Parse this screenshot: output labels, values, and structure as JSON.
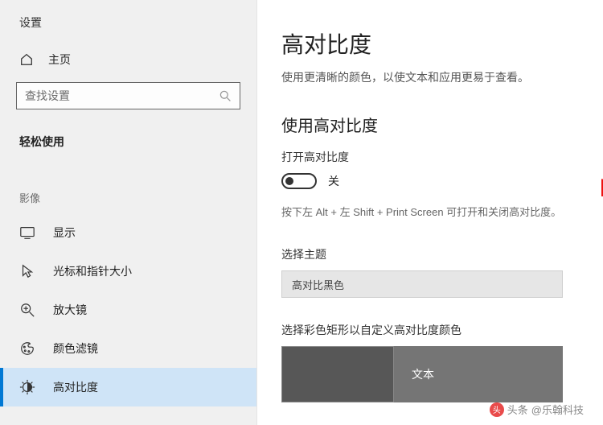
{
  "window": {
    "title": "设置"
  },
  "sidebar": {
    "home_label": "主页",
    "search_placeholder": "查找设置",
    "group_label": "轻松使用",
    "sub_group_label": "影像",
    "items": [
      {
        "label": "显示"
      },
      {
        "label": "光标和指针大小"
      },
      {
        "label": "放大镜"
      },
      {
        "label": "颜色滤镜"
      },
      {
        "label": "高对比度"
      }
    ]
  },
  "main": {
    "title": "高对比度",
    "subtitle": "使用更清晰的颜色，以使文本和应用更易于查看。",
    "section_heading": "使用高对比度",
    "toggle_label": "打开高对比度",
    "toggle_state": "关",
    "hotkey_hint": "按下左 Alt + 左 Shift + Print Screen 可打开和关闭高对比度。",
    "theme_label": "选择主题",
    "theme_value": "高对比黑色",
    "colors_label": "选择彩色矩形以自定义高对比度颜色",
    "swatch_text_label": "文本"
  },
  "watermark": {
    "prefix": "头条",
    "handle": "@乐翰科技"
  }
}
